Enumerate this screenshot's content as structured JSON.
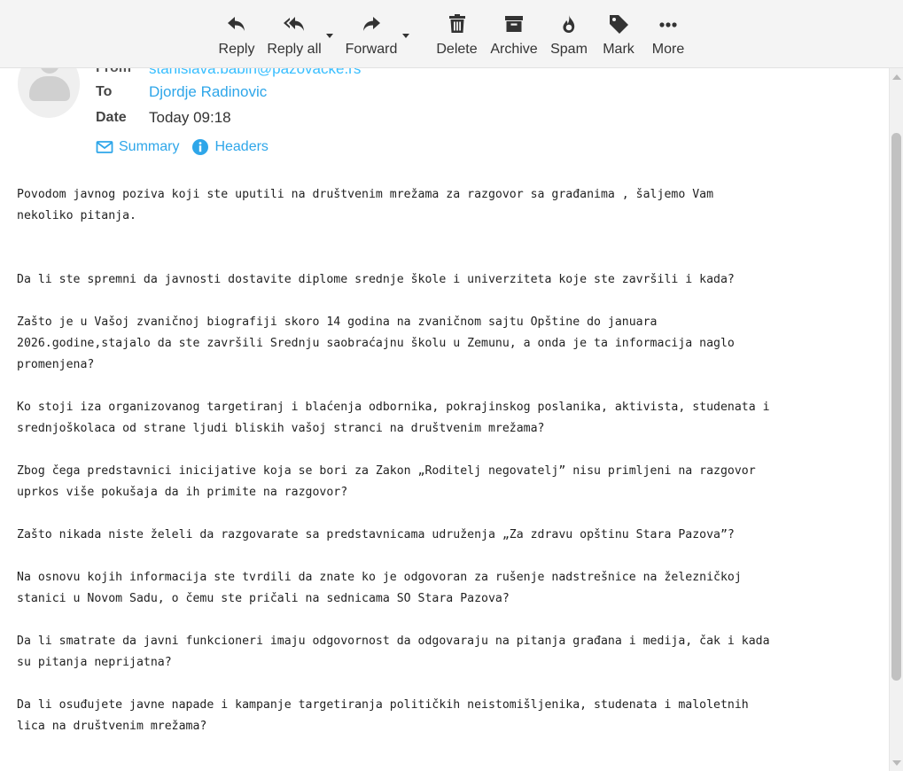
{
  "toolbar": {
    "reply": "Reply",
    "reply_all": "Reply all",
    "forward": "Forward",
    "delete": "Delete",
    "archive": "Archive",
    "spam": "Spam",
    "mark": "Mark",
    "more": "More"
  },
  "header": {
    "from_label": "From",
    "from_value": "stanislava.babin@pazovacke.rs",
    "to_label": "To",
    "to_value": "Djordje Radinovic",
    "date_label": "Date",
    "date_value": "Today 09:18",
    "summary_link": "Summary",
    "headers_link": "Headers"
  },
  "body": {
    "paragraphs": [
      "Povodom javnog poziva koji ste uputili na društvenim mrežama za razgovor sa građanima , šaljemo Vam\nnekoliko pitanja.",
      "Da li ste spremni da javnosti dostavite diplome srednje škole i univerziteta koje ste završili i kada?",
      "Zašto je u Vašoj zvaničnoj biografiji skoro 14 godina na zvaničnom sajtu Opštine do januara\n2026.godine,stajalo da ste završili Srednju saobraćajnu školu u Zemunu, a onda je ta informacija naglo\npromenjena?",
      "Ko stoji iza organizovanog targetiranj i blaćenja odbornika, pokrajinskog poslanika, aktivista, studenata i\nsrednjoškolaca od strane ljudi bliskih vašoj stranci na društvenim mrežama?",
      "Zbog čega predstavnici inicijative koja se bori za Zakon „Roditelj negovatelj” nisu primljeni na razgovor\nuprkos više pokušaja da ih primite na razgovor?",
      "Zašto nikada niste želeli da razgovarate sa predstavnicama udruženja „Za zdravu opštinu Stara Pazova”?",
      "Na osnovu kojih informacija ste tvrdili da znate ko je odgovoran za rušenje nadstrešnice na železničkoj\nstanici u Novom Sadu, o čemu ste pričali na sednicama SO Stara Pazova?",
      "Da li smatrate da javni funkcioneri imaju odgovornost da odgovaraju na pitanja građana i medija, čak i kada\nsu pitanja neprijatna?",
      "Da li osuđujete javne napade i kampanje targetiranja političkih neistomišljenika, studenata i maloletnih\nlica na društvenim mrežama?"
    ]
  },
  "colors": {
    "accent": "#2ea6e9",
    "toolbar_bg": "#f4f4f4",
    "icon": "#333333"
  },
  "icons": [
    "reply-icon",
    "reply-all-icon",
    "forward-icon",
    "trash-icon",
    "archive-icon",
    "fire-icon",
    "tag-icon",
    "ellipsis-icon",
    "envelope-icon",
    "info-icon",
    "avatar-icon"
  ]
}
